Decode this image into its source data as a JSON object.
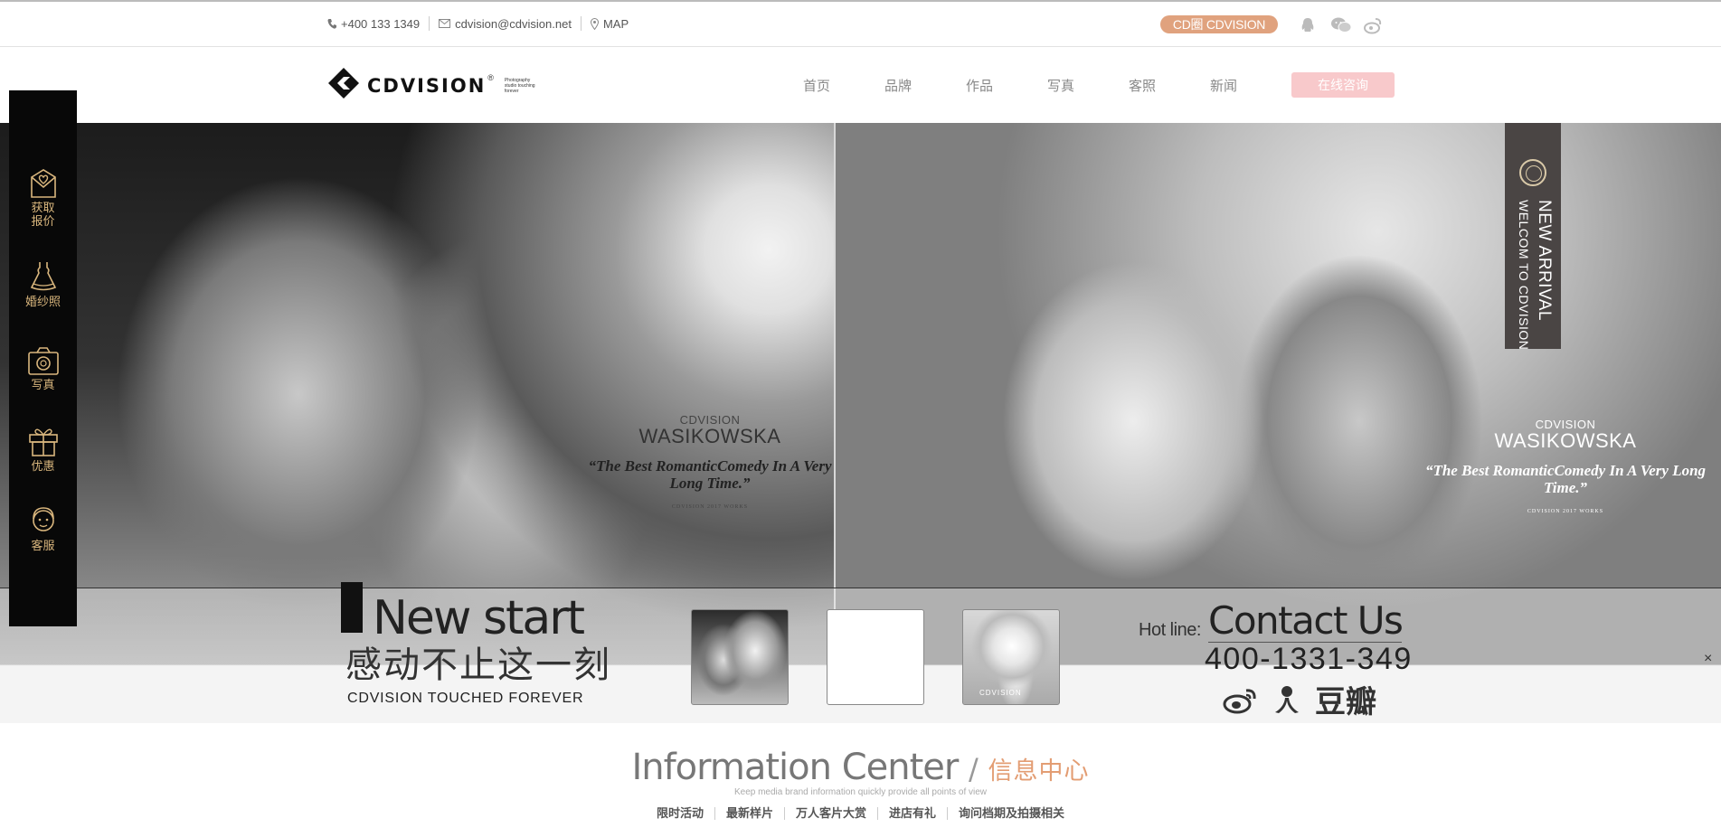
{
  "topbar": {
    "phone": "+400 133 1349",
    "email": "cdvision@cdvision.net",
    "map": "MAP",
    "brand_pill": "CD圈 CDVISION",
    "social_icons": [
      "qq-icon",
      "wechat-icon",
      "weibo-icon"
    ]
  },
  "header": {
    "logo_text": "CDVISION",
    "logo_reg": "®",
    "logo_tagline": "Photography studio touching forever",
    "nav": [
      "首页",
      "品牌",
      "作品",
      "写真",
      "客照",
      "新闻"
    ],
    "consult_label": "在线咨询"
  },
  "hero": {
    "left_caption": {
      "small": "CDVISION",
      "name": "WASIKOWSKA",
      "quote": "“The Best RomanticComedy In A Very Long Time.”",
      "works": "CDVISION 2017 WORKS"
    },
    "right_caption": {
      "small": "CDVISION",
      "name": "WASIKOWSKA",
      "quote": "“The Best RomanticComedy In A Very Long Time.”",
      "works": "CDVISION 2017 WORKS"
    },
    "arrival": {
      "line1": "NEW ARRIVAL",
      "line2": "WELCOM TO CDVISION"
    }
  },
  "sidebar": {
    "items": [
      {
        "label": "获取\n报价",
        "icon": "heart-envelope-icon"
      },
      {
        "label": "婚纱照",
        "icon": "wedding-dress-icon"
      },
      {
        "label": "写真",
        "icon": "camera-icon"
      },
      {
        "label": "优惠",
        "icon": "gift-icon"
      },
      {
        "label": "客服",
        "icon": "customer-service-icon"
      }
    ]
  },
  "bottom_bar": {
    "title": "New start",
    "cn_title": "感动不止这一刻",
    "en_sub": "CDVISION TOUCHED FOREVER",
    "thumb3_label": "CDVISION",
    "hotline_label": "Hot line:",
    "contact_title": "Contact Us",
    "phone": "400-1331-349",
    "douban": "豆瓣",
    "close": "×"
  },
  "info_center": {
    "title_en": "Information Center",
    "sep": "/",
    "title_cn": "信息中心",
    "subtitle": "Keep media brand information quickly provide all points of view",
    "tabs": [
      "限时活动",
      "最新样片",
      "万人客片大赏",
      "进店有礼",
      "询问档期及拍摄相关"
    ]
  },
  "colors": {
    "accent_orange": "#e0a27e",
    "consult_pink": "#f8c9cb",
    "sidebar_gold": "#d9b67d",
    "info_cn": "#e39d73"
  }
}
